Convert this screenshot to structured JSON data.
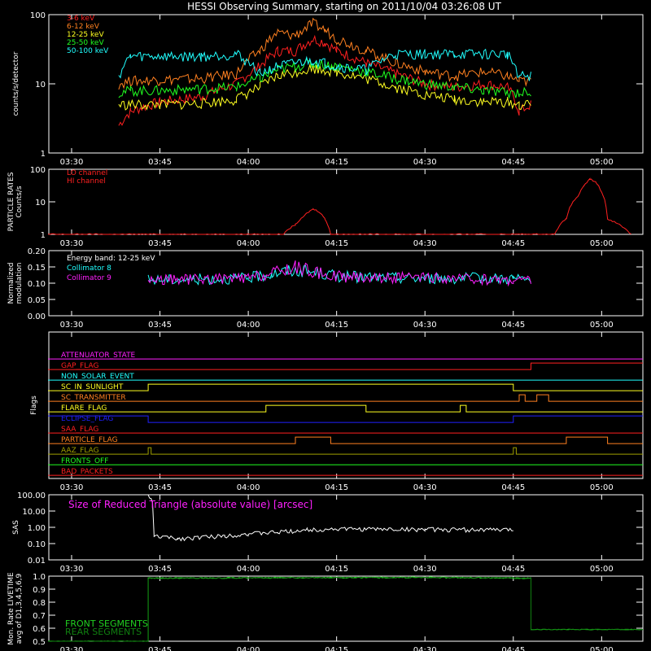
{
  "title": "HESSI Observing Summary, starting on 2011/10/04 03:26:08 UT",
  "time_ticks": [
    "03:30",
    "03:45",
    "04:00",
    "04:15",
    "04:30",
    "04:45",
    "05:00"
  ],
  "colors": {
    "c3_6": "#ff2020",
    "c6_12": "#ff8020",
    "c12_25": "#ffff20",
    "c25_50": "#20ff20",
    "c50_100": "#20ffff",
    "magenta": "#ff20ff",
    "white": "#ffffff",
    "green": "#20d020",
    "darkgreen": "#108010"
  },
  "chart_data": [
    {
      "type": "line",
      "panel": "counts",
      "ylabel": "counts/s/detector",
      "yscale": "log",
      "ylim": [
        1,
        100
      ],
      "ytick_labels": [
        "1",
        "10",
        "100"
      ],
      "series": [
        {
          "name": "3-6 keV",
          "color": "#ff2020",
          "x": [
            "03:38",
            "03:40",
            "03:45",
            "03:52",
            "03:58",
            "04:02",
            "04:05",
            "04:08",
            "04:11",
            "04:13",
            "04:15",
            "04:20",
            "04:25",
            "04:30",
            "04:35",
            "04:40",
            "04:44",
            "04:46",
            "04:48"
          ],
          "y": [
            2.5,
            4,
            5.5,
            6.5,
            10,
            18,
            30,
            30,
            45,
            40,
            30,
            20,
            14,
            10,
            9,
            10,
            9,
            4,
            5
          ]
        },
        {
          "name": "6-12 keV",
          "color": "#ff8020",
          "x": [
            "03:38",
            "03:40",
            "03:45",
            "03:52",
            "03:58",
            "04:02",
            "04:05",
            "04:08",
            "04:11",
            "04:13",
            "04:15",
            "04:20",
            "04:25",
            "04:30",
            "04:35",
            "04:40",
            "04:44",
            "04:46",
            "04:48"
          ],
          "y": [
            10,
            11,
            11.5,
            12,
            14,
            30,
            55,
            50,
            75,
            60,
            45,
            30,
            20,
            15,
            13,
            15,
            13,
            11,
            11
          ]
        },
        {
          "name": "12-25 keV",
          "color": "#ffff20",
          "x": [
            "03:38",
            "03:40",
            "03:45",
            "03:52",
            "03:58",
            "04:02",
            "04:05",
            "04:08",
            "04:11",
            "04:13",
            "04:15",
            "04:20",
            "04:25",
            "04:30",
            "04:35",
            "04:40",
            "04:44",
            "04:46",
            "04:48"
          ],
          "y": [
            5,
            5,
            5,
            5.2,
            6,
            9,
            13,
            15,
            17,
            16,
            15,
            12,
            9,
            7,
            6,
            5.5,
            5.5,
            5,
            5
          ]
        },
        {
          "name": "25-50 keV",
          "color": "#20ff20",
          "x": [
            "03:38",
            "03:40",
            "03:45",
            "03:52",
            "03:58",
            "04:02",
            "04:05",
            "04:08",
            "04:11",
            "04:13",
            "04:15",
            "04:20",
            "04:25",
            "04:30",
            "04:35",
            "04:40",
            "04:44",
            "04:46",
            "04:48"
          ],
          "y": [
            7.5,
            8,
            8,
            8.5,
            9,
            12,
            16,
            18,
            20,
            19,
            18,
            15,
            12,
            10,
            9,
            8,
            7.5,
            7.5,
            7.5
          ]
        },
        {
          "name": "50-100 keV",
          "color": "#20ffff",
          "x": [
            "03:38",
            "03:40",
            "03:45",
            "03:52",
            "03:58",
            "04:02",
            "04:05",
            "04:08",
            "04:11",
            "04:13",
            "04:15",
            "04:20",
            "04:25",
            "04:30",
            "04:35",
            "04:40",
            "04:44",
            "04:46",
            "04:48"
          ],
          "y": [
            13,
            25,
            25,
            25,
            27,
            14,
            18,
            20,
            22,
            20,
            18,
            16,
            27,
            27,
            27,
            27,
            27,
            13,
            13
          ]
        }
      ]
    },
    {
      "type": "line",
      "panel": "particle",
      "ylabel": "PARTICLE RATES\nCounts/s",
      "yscale": "log",
      "ylim": [
        1,
        100
      ],
      "ytick_labels": [
        "1",
        "10",
        "100"
      ],
      "series": [
        {
          "name": "LO channel",
          "color": "#ff2020",
          "x": [
            "03:26",
            "04:06",
            "04:08",
            "04:09",
            "04:10",
            "04:11",
            "04:12",
            "04:13",
            "04:14",
            "04:30",
            "04:52",
            "04:54",
            "04:56",
            "04:57",
            "04:58",
            "04:59",
            "05:00",
            "05:01",
            "05:05"
          ],
          "y": [
            1,
            1,
            2,
            3,
            4.5,
            6,
            5,
            3,
            1,
            1,
            1,
            3,
            15,
            30,
            50,
            40,
            20,
            3,
            1
          ]
        },
        {
          "name": "HI channel",
          "color": "#ff2020",
          "x": [],
          "y": []
        }
      ]
    },
    {
      "type": "line",
      "panel": "modulation",
      "ylabel": "Normalized\nmodulation",
      "ylim": [
        0,
        0.2
      ],
      "ytick_labels": [
        "0.00",
        "0.05",
        "0.10",
        "0.15",
        "0.20"
      ],
      "annotation": "Energy band: 12-25 keV",
      "series": [
        {
          "name": "Collimator 8",
          "color": "#20ffff",
          "x": [
            "03:43",
            "04:00",
            "04:04",
            "04:08",
            "04:12",
            "04:16",
            "04:30",
            "04:45",
            "04:48"
          ],
          "y": [
            0.11,
            0.115,
            0.13,
            0.14,
            0.13,
            0.12,
            0.115,
            0.115,
            0.11
          ]
        },
        {
          "name": "Collimator 9",
          "color": "#ff20ff",
          "x": [
            "03:43",
            "04:00",
            "04:04",
            "04:08",
            "04:12",
            "04:16",
            "04:30",
            "04:45",
            "04:48"
          ],
          "y": [
            0.11,
            0.115,
            0.13,
            0.15,
            0.13,
            0.12,
            0.115,
            0.11,
            0.11
          ]
        }
      ]
    },
    {
      "type": "line",
      "panel": "flags",
      "ylabel": "Flags",
      "series": [
        {
          "name": "ATTENUATOR_STATE",
          "color": "#ff20ff",
          "x": [
            "03:26",
            "05:07"
          ],
          "y": [
            0,
            0
          ]
        },
        {
          "name": "GAP_FLAG",
          "color": "#ff2020",
          "x": [
            "03:26",
            "04:48",
            "04:48",
            "05:07"
          ],
          "y": [
            0,
            0,
            1,
            1
          ]
        },
        {
          "name": "NON_SOLAR_EVENT",
          "color": "#20ffff",
          "x": [
            "03:26",
            "05:07"
          ],
          "y": [
            0,
            0
          ]
        },
        {
          "name": "SC_IN_SUNLIGHT",
          "color": "#ffff20",
          "x": [
            "03:26",
            "03:43",
            "03:43",
            "04:45",
            "04:45",
            "05:07"
          ],
          "y": [
            0,
            0,
            1,
            1,
            0,
            0
          ]
        },
        {
          "name": "SC_TRANSMITTER",
          "color": "#ff8020",
          "x": [
            "03:26",
            "04:46",
            "04:46",
            "04:47",
            "04:47",
            "04:49",
            "04:49",
            "04:51",
            "04:51",
            "05:07"
          ],
          "y": [
            0,
            0,
            1,
            1,
            0,
            0,
            1,
            1,
            0,
            0
          ]
        },
        {
          "name": "FLARE_FLAG",
          "color": "#ffff20",
          "x": [
            "03:26",
            "04:03",
            "04:03",
            "04:20",
            "04:20",
            "04:36",
            "04:36",
            "04:37",
            "04:37",
            "05:07"
          ],
          "y": [
            0,
            0,
            1,
            1,
            0,
            0,
            1,
            1,
            0,
            0
          ]
        },
        {
          "name": "ECLIPSE_FLAG",
          "color": "#2020ff",
          "x": [
            "03:26",
            "03:43",
            "03:43",
            "04:45",
            "04:45",
            "05:07"
          ],
          "y": [
            1,
            1,
            0,
            0,
            1,
            1
          ]
        },
        {
          "name": "SAA_FLAG",
          "color": "#ff2020",
          "x": [
            "03:26",
            "05:07"
          ],
          "y": [
            0,
            0
          ]
        },
        {
          "name": "PARTICLE_FLAG",
          "color": "#ff8020",
          "x": [
            "03:26",
            "04:08",
            "04:08",
            "04:14",
            "04:14",
            "04:54",
            "04:54",
            "05:01",
            "05:01",
            "05:07"
          ],
          "y": [
            0,
            0,
            1,
            1,
            0,
            0,
            1,
            1,
            0,
            0
          ]
        },
        {
          "name": "AAZ_FLAG",
          "color": "#a0a000",
          "x": [
            "03:26",
            "03:43",
            "03:43",
            "03:43.5",
            "03:43.5",
            "04:45",
            "04:45",
            "04:45.5",
            "04:45.5",
            "05:07"
          ],
          "y": [
            0,
            0,
            1,
            1,
            0,
            0,
            1,
            1,
            0,
            0
          ]
        },
        {
          "name": "FRONTS_OFF",
          "color": "#20ff20",
          "x": [
            "03:26",
            "05:07"
          ],
          "y": [
            0,
            0
          ]
        },
        {
          "name": "BAD_PACKETS",
          "color": "#ff2020",
          "x": [
            "03:26",
            "05:07"
          ],
          "y": [
            0,
            0
          ]
        }
      ]
    },
    {
      "type": "line",
      "panel": "sas",
      "ylabel": "SAS",
      "yscale": "log",
      "ylim": [
        0.01,
        100
      ],
      "ytick_labels": [
        "0.01",
        "0.10",
        "1.00",
        "10.00",
        "100.00"
      ],
      "annotation": "Size of Reduced Triangle (absolute value) [arcsec]",
      "series": [
        {
          "name": "",
          "color": "#ffffff",
          "x": [
            "03:43",
            "03:44",
            "03:48",
            "03:52",
            "03:56",
            "04:00",
            "04:05",
            "04:10",
            "04:15",
            "04:30",
            "04:45"
          ],
          "y": [
            100,
            0.3,
            0.2,
            0.25,
            0.3,
            0.4,
            0.5,
            0.7,
            0.8,
            0.75,
            0.7
          ]
        }
      ]
    },
    {
      "type": "line",
      "panel": "livetime",
      "ylabel": "Mon. Rate LIVETIME\navg of D1,3,4,5,6,9",
      "ylim": [
        0.5,
        1.0
      ],
      "ytick_labels": [
        "0.5",
        "0.6",
        "0.7",
        "0.8",
        "0.9",
        "1.0"
      ],
      "series": [
        {
          "name": "FRONT SEGMENTS",
          "color": "#20d020",
          "x": [
            "03:26",
            "03:43",
            "03:43",
            "04:30",
            "04:48",
            "04:48",
            "05:07"
          ],
          "y": [
            0.5,
            0.5,
            0.985,
            0.99,
            0.985,
            0.59,
            0.59
          ]
        },
        {
          "name": "REAR SEGMENTS",
          "color": "#108010",
          "x": [
            "03:26",
            "03:43",
            "03:43",
            "04:30",
            "04:48",
            "04:48",
            "05:07"
          ],
          "y": [
            0.5,
            0.5,
            0.985,
            0.99,
            0.985,
            0.59,
            0.59
          ]
        }
      ]
    }
  ]
}
